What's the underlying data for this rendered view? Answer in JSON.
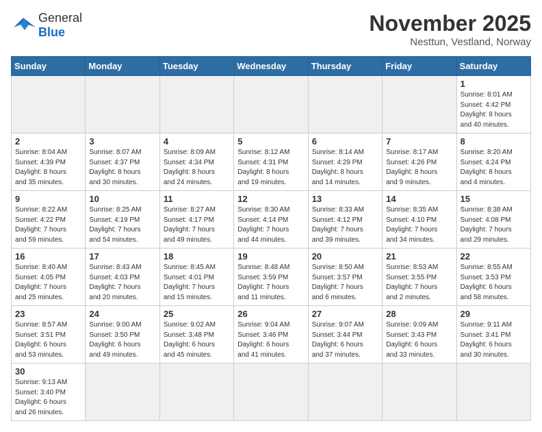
{
  "header": {
    "logo_general": "General",
    "logo_blue": "Blue",
    "month_title": "November 2025",
    "location": "Nesttun, Vestland, Norway"
  },
  "weekdays": [
    "Sunday",
    "Monday",
    "Tuesday",
    "Wednesday",
    "Thursday",
    "Friday",
    "Saturday"
  ],
  "weeks": [
    [
      {
        "day": "",
        "info": "",
        "empty": true
      },
      {
        "day": "",
        "info": "",
        "empty": true
      },
      {
        "day": "",
        "info": "",
        "empty": true
      },
      {
        "day": "",
        "info": "",
        "empty": true
      },
      {
        "day": "",
        "info": "",
        "empty": true
      },
      {
        "day": "",
        "info": "",
        "empty": true
      },
      {
        "day": "1",
        "info": "Sunrise: 8:01 AM\nSunset: 4:42 PM\nDaylight: 8 hours\nand 40 minutes.",
        "empty": false
      }
    ],
    [
      {
        "day": "2",
        "info": "Sunrise: 8:04 AM\nSunset: 4:39 PM\nDaylight: 8 hours\nand 35 minutes.",
        "empty": false
      },
      {
        "day": "3",
        "info": "Sunrise: 8:07 AM\nSunset: 4:37 PM\nDaylight: 8 hours\nand 30 minutes.",
        "empty": false
      },
      {
        "day": "4",
        "info": "Sunrise: 8:09 AM\nSunset: 4:34 PM\nDaylight: 8 hours\nand 24 minutes.",
        "empty": false
      },
      {
        "day": "5",
        "info": "Sunrise: 8:12 AM\nSunset: 4:31 PM\nDaylight: 8 hours\nand 19 minutes.",
        "empty": false
      },
      {
        "day": "6",
        "info": "Sunrise: 8:14 AM\nSunset: 4:29 PM\nDaylight: 8 hours\nand 14 minutes.",
        "empty": false
      },
      {
        "day": "7",
        "info": "Sunrise: 8:17 AM\nSunset: 4:26 PM\nDaylight: 8 hours\nand 9 minutes.",
        "empty": false
      },
      {
        "day": "8",
        "info": "Sunrise: 8:20 AM\nSunset: 4:24 PM\nDaylight: 8 hours\nand 4 minutes.",
        "empty": false
      }
    ],
    [
      {
        "day": "9",
        "info": "Sunrise: 8:22 AM\nSunset: 4:22 PM\nDaylight: 7 hours\nand 59 minutes.",
        "empty": false
      },
      {
        "day": "10",
        "info": "Sunrise: 8:25 AM\nSunset: 4:19 PM\nDaylight: 7 hours\nand 54 minutes.",
        "empty": false
      },
      {
        "day": "11",
        "info": "Sunrise: 8:27 AM\nSunset: 4:17 PM\nDaylight: 7 hours\nand 49 minutes.",
        "empty": false
      },
      {
        "day": "12",
        "info": "Sunrise: 8:30 AM\nSunset: 4:14 PM\nDaylight: 7 hours\nand 44 minutes.",
        "empty": false
      },
      {
        "day": "13",
        "info": "Sunrise: 8:33 AM\nSunset: 4:12 PM\nDaylight: 7 hours\nand 39 minutes.",
        "empty": false
      },
      {
        "day": "14",
        "info": "Sunrise: 8:35 AM\nSunset: 4:10 PM\nDaylight: 7 hours\nand 34 minutes.",
        "empty": false
      },
      {
        "day": "15",
        "info": "Sunrise: 8:38 AM\nSunset: 4:08 PM\nDaylight: 7 hours\nand 29 minutes.",
        "empty": false
      }
    ],
    [
      {
        "day": "16",
        "info": "Sunrise: 8:40 AM\nSunset: 4:05 PM\nDaylight: 7 hours\nand 25 minutes.",
        "empty": false
      },
      {
        "day": "17",
        "info": "Sunrise: 8:43 AM\nSunset: 4:03 PM\nDaylight: 7 hours\nand 20 minutes.",
        "empty": false
      },
      {
        "day": "18",
        "info": "Sunrise: 8:45 AM\nSunset: 4:01 PM\nDaylight: 7 hours\nand 15 minutes.",
        "empty": false
      },
      {
        "day": "19",
        "info": "Sunrise: 8:48 AM\nSunset: 3:59 PM\nDaylight: 7 hours\nand 11 minutes.",
        "empty": false
      },
      {
        "day": "20",
        "info": "Sunrise: 8:50 AM\nSunset: 3:57 PM\nDaylight: 7 hours\nand 6 minutes.",
        "empty": false
      },
      {
        "day": "21",
        "info": "Sunrise: 8:53 AM\nSunset: 3:55 PM\nDaylight: 7 hours\nand 2 minutes.",
        "empty": false
      },
      {
        "day": "22",
        "info": "Sunrise: 8:55 AM\nSunset: 3:53 PM\nDaylight: 6 hours\nand 58 minutes.",
        "empty": false
      }
    ],
    [
      {
        "day": "23",
        "info": "Sunrise: 8:57 AM\nSunset: 3:51 PM\nDaylight: 6 hours\nand 53 minutes.",
        "empty": false
      },
      {
        "day": "24",
        "info": "Sunrise: 9:00 AM\nSunset: 3:50 PM\nDaylight: 6 hours\nand 49 minutes.",
        "empty": false
      },
      {
        "day": "25",
        "info": "Sunrise: 9:02 AM\nSunset: 3:48 PM\nDaylight: 6 hours\nand 45 minutes.",
        "empty": false
      },
      {
        "day": "26",
        "info": "Sunrise: 9:04 AM\nSunset: 3:46 PM\nDaylight: 6 hours\nand 41 minutes.",
        "empty": false
      },
      {
        "day": "27",
        "info": "Sunrise: 9:07 AM\nSunset: 3:44 PM\nDaylight: 6 hours\nand 37 minutes.",
        "empty": false
      },
      {
        "day": "28",
        "info": "Sunrise: 9:09 AM\nSunset: 3:43 PM\nDaylight: 6 hours\nand 33 minutes.",
        "empty": false
      },
      {
        "day": "29",
        "info": "Sunrise: 9:11 AM\nSunset: 3:41 PM\nDaylight: 6 hours\nand 30 minutes.",
        "empty": false
      }
    ],
    [
      {
        "day": "30",
        "info": "Sunrise: 9:13 AM\nSunset: 3:40 PM\nDaylight: 6 hours\nand 26 minutes.",
        "empty": false
      },
      {
        "day": "",
        "info": "",
        "empty": true
      },
      {
        "day": "",
        "info": "",
        "empty": true
      },
      {
        "day": "",
        "info": "",
        "empty": true
      },
      {
        "day": "",
        "info": "",
        "empty": true
      },
      {
        "day": "",
        "info": "",
        "empty": true
      },
      {
        "day": "",
        "info": "",
        "empty": true
      }
    ]
  ]
}
